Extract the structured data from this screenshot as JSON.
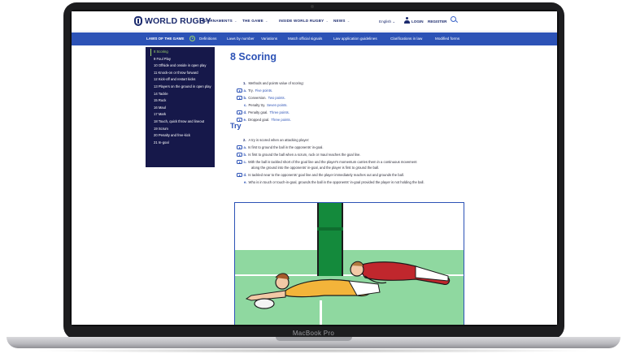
{
  "header": {
    "logo_text": "WORLD RUGBY",
    "nav": [
      "TOURNAMENTS",
      "THE GAME",
      "INSIDE WORLD RUGBY",
      "NEWS"
    ],
    "chevron": "⌄",
    "language": "English ⌄",
    "login": "LOGIN",
    "register": "REGISTER"
  },
  "subnav": {
    "laws_title": "LAWS OF THE GAME",
    "items": [
      "Definitions",
      "Laws by number",
      "Variations",
      "Match official signals",
      "Law application guidelines",
      "Clarifications in law",
      "Modified forms"
    ]
  },
  "sidebar": {
    "items": [
      "8 Scoring",
      "9 Foul Play",
      "10 Offside and onside in open play",
      "11 Knock-on or throw forward",
      "12 Kick-off and restart kicks",
      "13 Players on the ground in open play",
      "14 Tackle",
      "15 Ruck",
      "16 Maul",
      "17 Mark",
      "18 Touch, quick throw and lineout",
      "19 Scrum",
      "20 Penalty and free-kick",
      "21 In-goal"
    ],
    "active_index": 0
  },
  "content": {
    "title": "8 Scoring",
    "intro": {
      "num": "1.",
      "text": "Methods and points value of scoring:"
    },
    "scoring": [
      {
        "video": true,
        "letter": "a.",
        "label": "Try.",
        "points": "Five points."
      },
      {
        "video": true,
        "letter": "b.",
        "label": "Conversion.",
        "points": "Two points."
      },
      {
        "video": false,
        "letter": "c.",
        "label": "Penalty try.",
        "points": "Seven points."
      },
      {
        "video": true,
        "letter": "d.",
        "label": "Penalty goal.",
        "points": "Three points."
      },
      {
        "video": true,
        "letter": "e.",
        "label": "Dropped goal.",
        "points": "Three points."
      }
    ],
    "try_heading": "Try",
    "try_intro": {
      "num": "2.",
      "text": "A try is scored when an attacking player:"
    },
    "try_items": [
      {
        "video": true,
        "letter": "a.",
        "text": "Is first to ground the ball in the opponents' in-goal."
      },
      {
        "video": true,
        "letter": "b.",
        "text": "Is first to ground the ball when a scrum, ruck or maul reaches the goal line."
      },
      {
        "video": true,
        "letter": "c.",
        "text": "With the ball is tackled short of the goal line and the player's momentum carries them in a continuous movement"
      },
      {
        "video": false,
        "letter": "",
        "text": "along the ground into the opponents' in-goal, and the player is first to ground the ball."
      },
      {
        "video": true,
        "letter": "d.",
        "text": "Is tackled near to the opponents' goal line and the player immediately reaches out and grounds the ball."
      },
      {
        "video": false,
        "letter": "e.",
        "text": "Who is in touch or touch-in-goal, grounds the ball in the opponents' in-goal provided the player is not holding the ball."
      }
    ]
  },
  "device_label": "MacBook Pro",
  "colors": {
    "brand_navy": "#1c2b6e",
    "nav_blue": "#2c52b6",
    "sidebar_bg": "#16184a",
    "accent_green": "#9fd66a"
  }
}
